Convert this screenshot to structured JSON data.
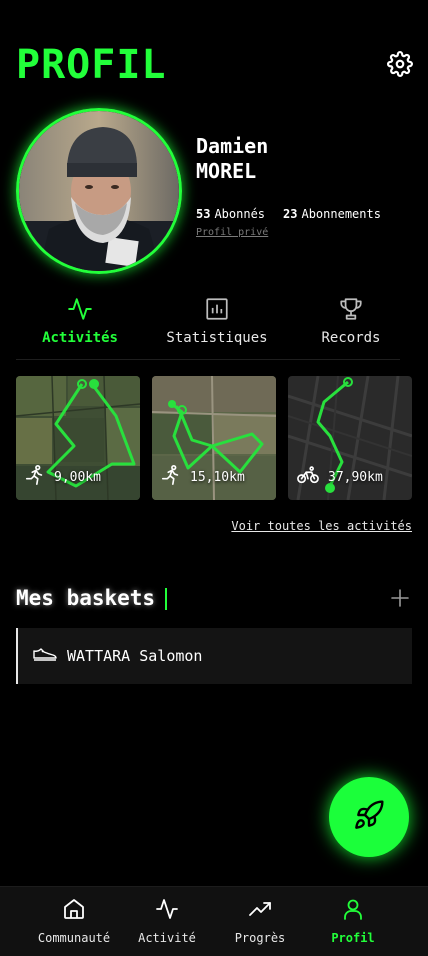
{
  "header": {
    "title": "PROFIL",
    "settings_icon": "gear-icon"
  },
  "profile": {
    "first_name": "Damien",
    "last_name": "MOREL",
    "followers_count": "53",
    "followers_label": "Abonnés",
    "following_count": "23",
    "following_label": "Abonnements",
    "privacy_label": "Profil privé"
  },
  "tabs": [
    {
      "label": "Activités",
      "icon": "activity-icon",
      "active": true
    },
    {
      "label": "Statistiques",
      "icon": "bar-chart-icon",
      "active": false
    },
    {
      "label": "Records",
      "icon": "trophy-icon",
      "active": false
    }
  ],
  "activities": [
    {
      "distance": "9,00km",
      "sport_icon": "running-icon"
    },
    {
      "distance": "15,10km",
      "sport_icon": "running-icon"
    },
    {
      "distance": "37,90km",
      "sport_icon": "cycling-icon"
    }
  ],
  "see_all_label": "Voir toutes les activités",
  "shoes": {
    "title": "Mes baskets",
    "add_icon": "plus-icon",
    "items": [
      {
        "name": "WATTARA Salomon",
        "icon": "shoe-icon"
      }
    ]
  },
  "fab": {
    "icon": "rocket-icon"
  },
  "bottom_nav": [
    {
      "label": "Communauté",
      "icon": "home-icon",
      "active": false
    },
    {
      "label": "Activité",
      "icon": "activity-icon",
      "active": false
    },
    {
      "label": "Progrès",
      "icon": "trending-up-icon",
      "active": false
    },
    {
      "label": "Profil",
      "icon": "user-icon",
      "active": true
    }
  ],
  "colors": {
    "accent": "#22ff3a",
    "background": "#000000",
    "surface": "#141414"
  }
}
